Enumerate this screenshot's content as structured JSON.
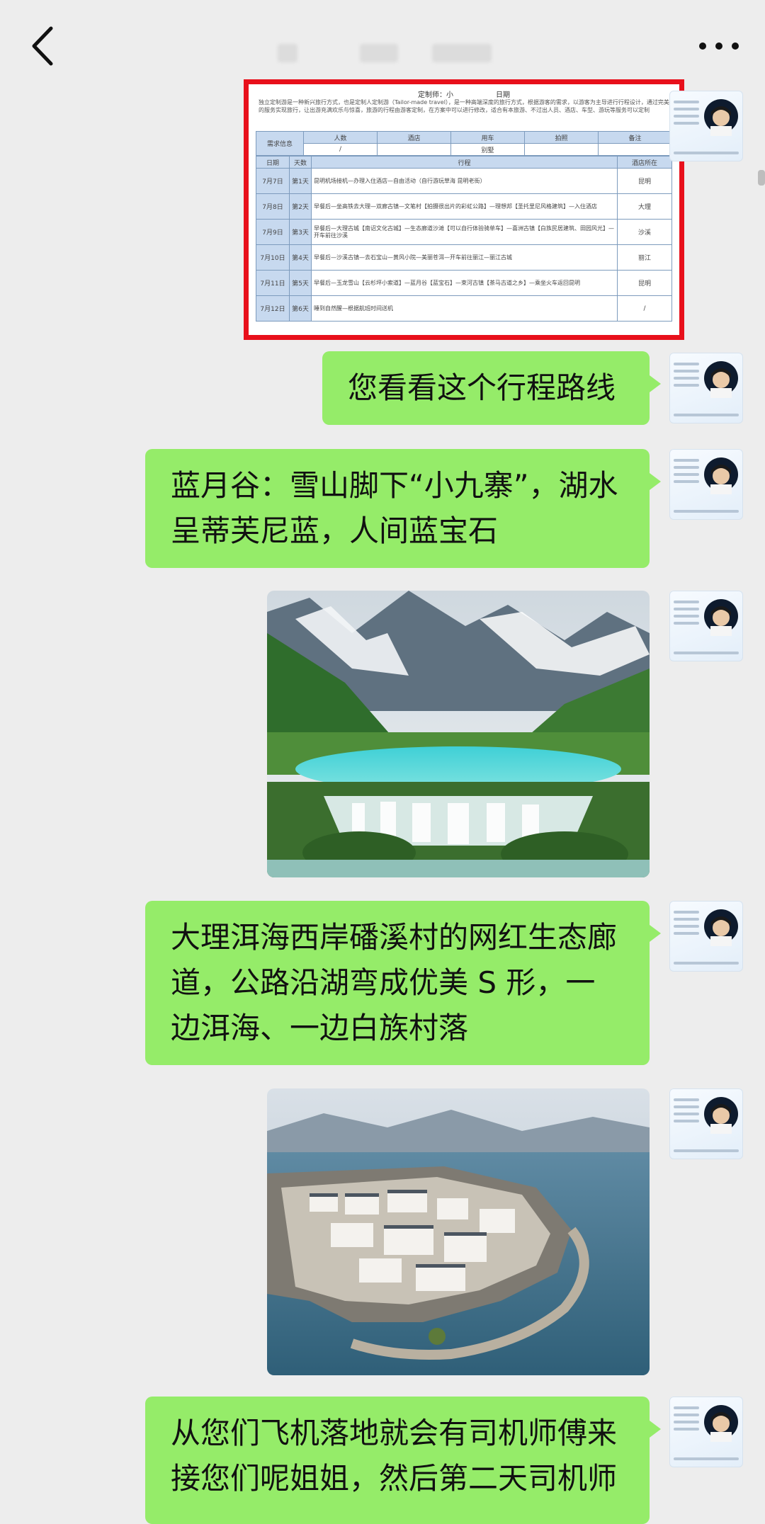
{
  "topbar": {
    "back_icon": "chevron-left-icon",
    "more_icon": "more-dots-icon"
  },
  "itinerary": {
    "heading": [
      "定制师：小",
      "日期"
    ],
    "intro": "独立定制游是一种新兴旅行方式，也是定制人定制游（Tailor-made travel），是一种高端深度的旅行方式，根据游客的需求，以游客为主导进行行程设计，通过完美的服务实现旅行，让出游充满欢乐与惊喜，旅游的行程由游客定制，在方案中可以进行修改，适合有本旅游、不过出人员、酒店、车型、游玩等服务可以定制",
    "header_row": [
      "人数",
      "酒店",
      "用车",
      "拍照",
      "备注"
    ],
    "first_col_label": "需求信息",
    "sub_row": [
      "/",
      "",
      "别墅",
      "",
      ""
    ],
    "columns": [
      "日期",
      "天数",
      "行程",
      "酒店所在"
    ],
    "rows": [
      {
        "date": "7月7日",
        "day": "第1天",
        "plan": "昆明机场接机—办理入住酒店—自由活动（自行游玩草海 昆明老街）",
        "hotel": "昆明"
      },
      {
        "date": "7月8日",
        "day": "第2天",
        "plan": "早餐后—坐高铁去大理—双廊古镇—文笔村【拍摄很出片的彩虹公路】—理想邦【圣托里尼风格建筑】—入住酒店",
        "hotel": "大理"
      },
      {
        "date": "7月9日",
        "day": "第3天",
        "plan": "早餐后—大理古城【南诏文化古城】—生态廊道沙滩【可以自行体验骑单车】—喜洲古镇【白族民居建筑、田园风光】—开车前往沙溪",
        "hotel": "沙溪"
      },
      {
        "date": "7月10日",
        "day": "第4天",
        "plan": "早餐后—沙溪古镇—去石宝山—黄风小院—美丽苍洱—开车前往丽江—丽江古城",
        "hotel": "丽江"
      },
      {
        "date": "7月11日",
        "day": "第5天",
        "plan": "早餐后—玉龙雪山【云杉坪小索道】—蓝月谷【蓝宝石】—束河古镇【茶马古道之乡】—乘坐火车返回昆明",
        "hotel": "昆明"
      },
      {
        "date": "7月12日",
        "day": "第6天",
        "plan": "睡到自然醒—根据航班时间送机",
        "hotel": "/"
      }
    ]
  },
  "messages": [
    {
      "type": "text",
      "text": "您看看这个行程路线"
    },
    {
      "type": "text",
      "text": "蓝月谷：雪山脚下“小九寨”，湖水呈蒂芙尼蓝，人间蓝宝石"
    },
    {
      "type": "image"
    },
    {
      "type": "text",
      "text": "大理洱海西岸磻溪村的网红生态廊道，公路沿湖弯成优美 S 形，一边洱海、一边白族村落"
    },
    {
      "type": "image"
    },
    {
      "type": "text",
      "text": "从您们飞机落地就会有司机师傅来接您们呢姐姐，然后第二天司机师"
    }
  ],
  "colors": {
    "bubble": "#95ec69",
    "background": "#ededed",
    "highlight_border": "#e8101b"
  }
}
